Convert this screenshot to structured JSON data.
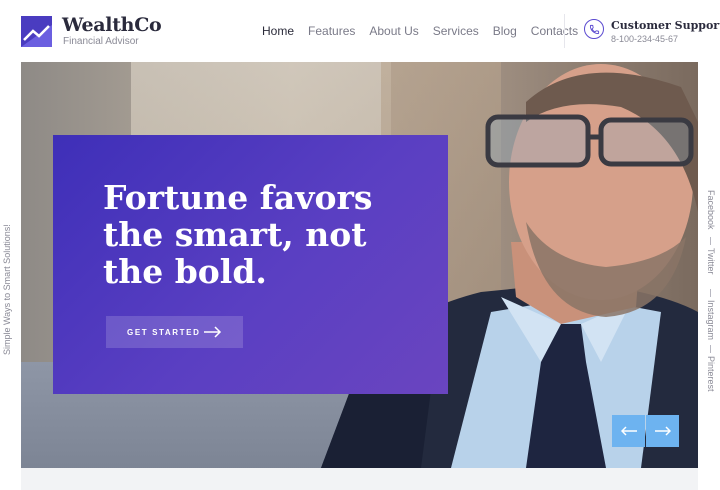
{
  "brand": {
    "name": "WealthCo",
    "tagline": "Financial Advisor",
    "accent_color": "#4a3cc0"
  },
  "nav": {
    "items": [
      {
        "label": "Home",
        "active": true
      },
      {
        "label": "Features",
        "active": false
      },
      {
        "label": "About Us",
        "active": false
      },
      {
        "label": "Services",
        "active": false
      },
      {
        "label": "Blog",
        "active": false
      },
      {
        "label": "Contacts",
        "active": false
      }
    ]
  },
  "support": {
    "title": "Customer Support",
    "phone": "8-100-234-45-67",
    "icon": "phone-icon"
  },
  "hero": {
    "headline": "Fortune favors the smart, not the bold.",
    "cta_label": "GET STARTED",
    "card_color": "#4a35bd",
    "slider_color": "#6db3f0"
  },
  "side_text": "Simple Ways to Smart Solutions!",
  "social": [
    "Facebook",
    "Twitter",
    "Instagram",
    "Pinterest"
  ]
}
